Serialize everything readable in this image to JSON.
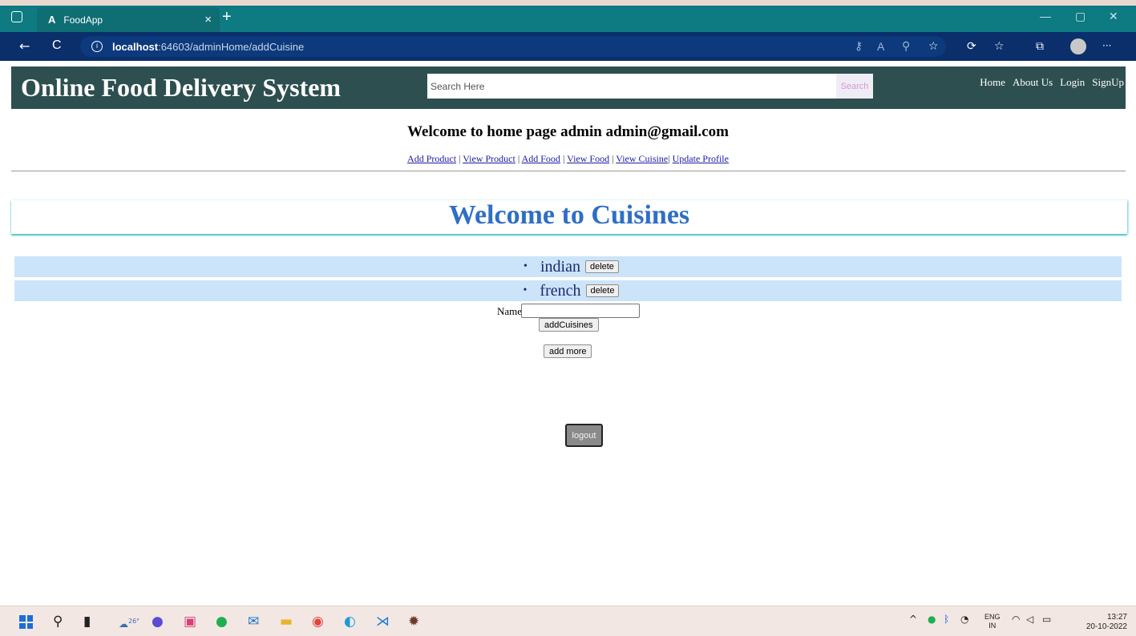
{
  "browser": {
    "tab_icon": "A",
    "tab_title": "FoodApp",
    "tab_close": "×",
    "new_tab": "+",
    "window_controls": {
      "minimize": "—",
      "restore": "▢",
      "close": "✕"
    },
    "nav": {
      "back": "←",
      "refresh": "C"
    },
    "url": {
      "info_icon": "i",
      "host": "localhost",
      "rest": ":64603/adminHome/addCuisine"
    },
    "menu_glyph": "···"
  },
  "header": {
    "brand": "Online Food Delivery System",
    "search_placeholder": "Search Here",
    "search_button": "Search",
    "nav": [
      "Home",
      "About Us",
      "Login",
      "SignUp"
    ]
  },
  "welcome": "Welcome to home page admin admin@gmail.com",
  "admin_links": {
    "add_product": "Add Product",
    "view_product": "View Product",
    "add_food": "Add Food",
    "view_food": "View Food",
    "view_cuisine": "View Cuisine",
    "update_profile": "Update Profile",
    "separator": " | ",
    "tight_separator": "| "
  },
  "cuisines": {
    "title": "Welcome to Cuisines",
    "items": [
      {
        "bullet": "•",
        "name": "indian",
        "action": "delete"
      },
      {
        "bullet": "•",
        "name": "french",
        "action": "delete"
      }
    ]
  },
  "form": {
    "name_label": "Name",
    "name_value": "",
    "add_button": "addCuisines",
    "add_more_button": "add more"
  },
  "logout_button": "logout",
  "taskbar": {
    "weather_temp": "26°",
    "lang_top": "ENG",
    "lang_bottom": "IN",
    "tray_caret": "^",
    "time": "13:27",
    "date": "20-10-2022"
  },
  "colors": {
    "tabbar": "#0e7a82",
    "address_bar": "#0a2f6b",
    "site_header": "#2e4f4f",
    "cuisine_title": "#2f6fc4",
    "list_row": "#cce4f9",
    "link": "#1a1aa6"
  }
}
